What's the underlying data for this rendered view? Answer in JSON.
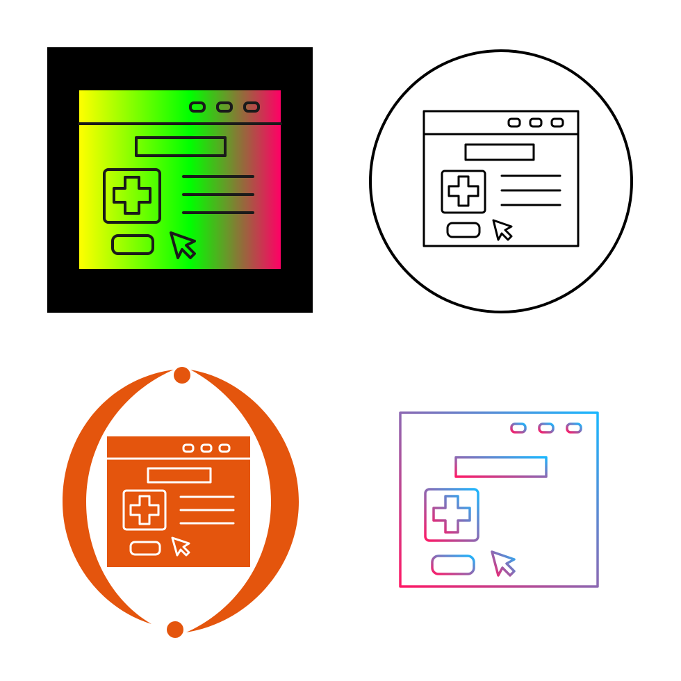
{
  "icon_set": {
    "subject": "medical-website-icon",
    "variants": [
      {
        "style": "gradient-glyph",
        "background": "#000000",
        "gradient": [
          "#ffff00",
          "#00ff00",
          "#ff0066"
        ],
        "stroke": "#222222"
      },
      {
        "style": "outline-in-circle",
        "stroke": "#000000",
        "background": "#ffffff"
      },
      {
        "style": "solid-with-circular-arrows",
        "fill": "#e4550d",
        "line": "#ffffff"
      },
      {
        "style": "gradient-line",
        "gradient": [
          "#ff1a66",
          "#1ab8ff"
        ]
      }
    ]
  }
}
